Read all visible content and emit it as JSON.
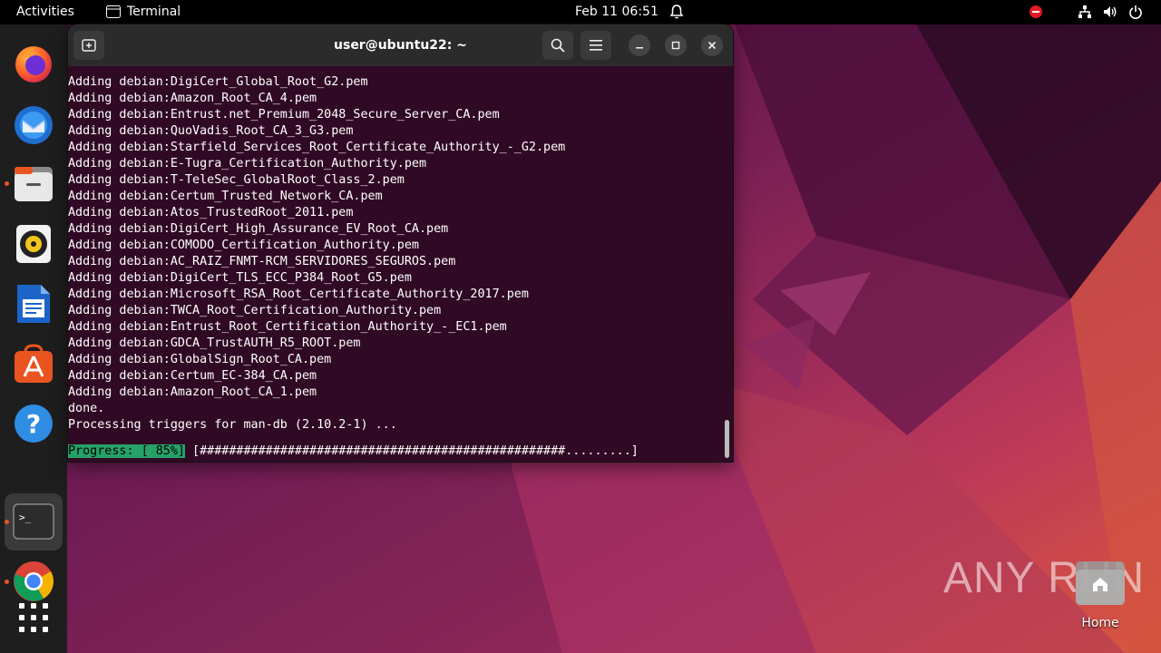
{
  "topbar": {
    "activities": "Activities",
    "app_name": "Terminal",
    "clock": "Feb 11  06:51"
  },
  "terminal": {
    "title": "user@ubuntu22: ~",
    "lines": [
      "Adding debian:DigiCert_Global_Root_G2.pem",
      "Adding debian:Amazon_Root_CA_4.pem",
      "Adding debian:Entrust.net_Premium_2048_Secure_Server_CA.pem",
      "Adding debian:QuoVadis_Root_CA_3_G3.pem",
      "Adding debian:Starfield_Services_Root_Certificate_Authority_-_G2.pem",
      "Adding debian:E-Tugra_Certification_Authority.pem",
      "Adding debian:T-TeleSec_GlobalRoot_Class_2.pem",
      "Adding debian:Certum_Trusted_Network_CA.pem",
      "Adding debian:Atos_TrustedRoot_2011.pem",
      "Adding debian:DigiCert_High_Assurance_EV_Root_CA.pem",
      "Adding debian:COMODO_Certification_Authority.pem",
      "Adding debian:AC_RAIZ_FNMT-RCM_SERVIDORES_SEGUROS.pem",
      "Adding debian:DigiCert_TLS_ECC_P384_Root_G5.pem",
      "Adding debian:Microsoft_RSA_Root_Certificate_Authority_2017.pem",
      "Adding debian:TWCA_Root_Certification_Authority.pem",
      "Adding debian:Entrust_Root_Certification_Authority_-_EC1.pem",
      "Adding debian:GDCA_TrustAUTH_R5_ROOT.pem",
      "Adding debian:GlobalSign_Root_CA.pem",
      "Adding debian:Certum_EC-384_CA.pem",
      "Adding debian:Amazon_Root_CA_1.pem",
      "done.",
      "Processing triggers for man-db (2.10.2-1) ..."
    ],
    "progress_label": "Progress: [ 85%]",
    "progress_bar": " [##################################################.........]",
    "progress_percent": 85
  },
  "desktop": {
    "home_label": "Home",
    "watermark": "ANY RUN"
  },
  "dock": {
    "icons": [
      "firefox-icon",
      "thunderbird-icon",
      "files-icon",
      "rhythmbox-icon",
      "libreoffice-writer-icon",
      "app-center-icon",
      "help-icon",
      "terminal-icon",
      "chrome-icon",
      "show-apps-icon"
    ]
  },
  "colors": {
    "terminal_bg": "#300a24",
    "header_bg": "#2b2b2b",
    "progress_green": "#26a269",
    "accent": "#e95420"
  }
}
